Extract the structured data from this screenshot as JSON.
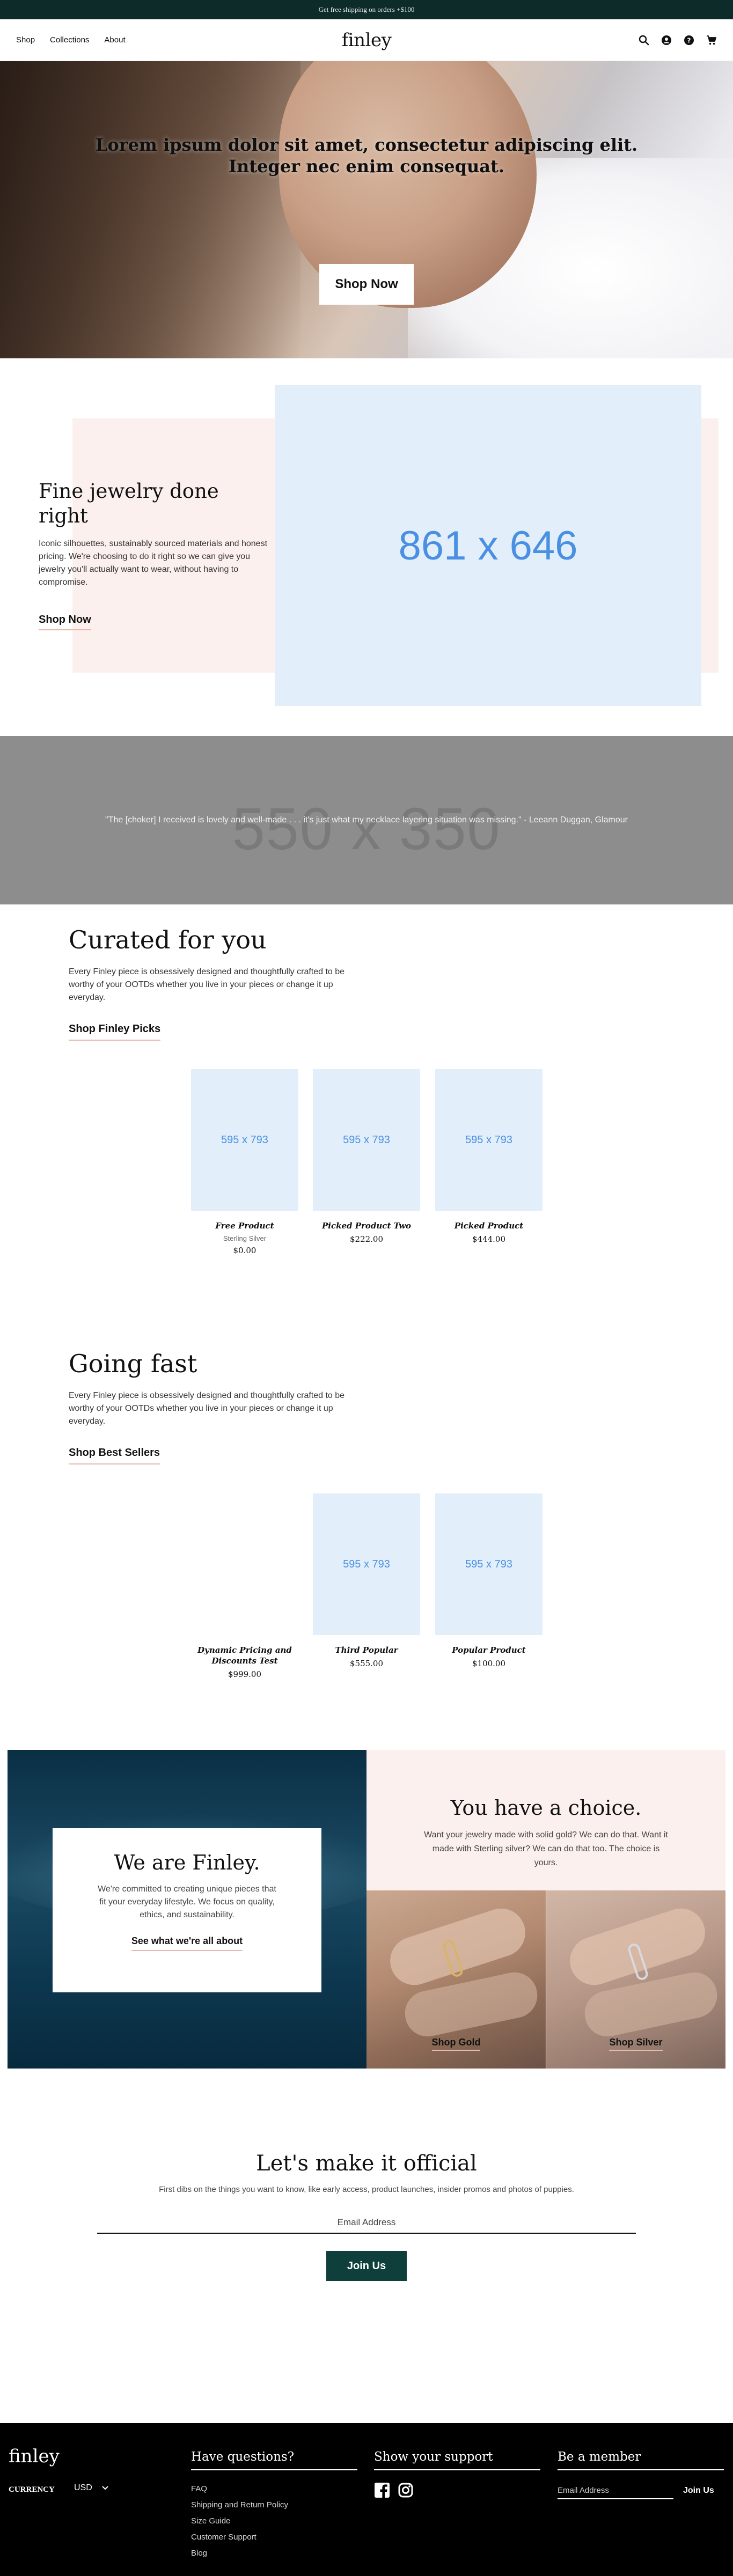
{
  "announcement": "Get free shipping on orders +$100",
  "header": {
    "nav": [
      "Shop",
      "Collections",
      "About"
    ],
    "logo": "finley",
    "icons": [
      "search-icon",
      "account-icon",
      "help-icon",
      "cart-icon"
    ]
  },
  "hero": {
    "title": "Lorem ipsum dolor sit amet, consectetur adipiscing elit. Integer nec enim consequat.",
    "button": "Shop Now"
  },
  "fine_jewelry": {
    "title": "Fine jewelry done right",
    "text": "Iconic silhouettes, sustainably sourced materials and honest pricing. We're choosing to do it right so we can give you jewelry you'll actually want to wear, without having to compromise.",
    "link": "Shop Now",
    "image_placeholder": "861 x 646"
  },
  "quote": {
    "placeholder": "550 x 350",
    "text": "\"The [choker] I received is lovely and well-made . . . it's just what my necklace layering situation was missing.\" - Leeann Duggan, Glamour"
  },
  "curated": {
    "title": "Curated for you",
    "text": "Every Finley piece is obsessively designed and thoughtfully crafted to be worthy of your OOTDs whether you live in your pieces or change it up everyday.",
    "link": "Shop Finley Picks",
    "products": [
      {
        "placeholder": "595 x 793",
        "name": "Free Product",
        "variant": "Sterling Silver",
        "price": "$0.00"
      },
      {
        "placeholder": "595 x 793",
        "name": "Picked Product Two",
        "variant": "",
        "price": "$222.00"
      },
      {
        "placeholder": "595 x 793",
        "name": "Picked Product",
        "variant": "",
        "price": "$444.00"
      }
    ]
  },
  "going_fast": {
    "title": "Going fast",
    "text": "Every Finley piece is obsessively designed and thoughtfully crafted to be worthy of your OOTDs whether you live in your pieces or change it up everyday.",
    "link": "Shop Best Sellers",
    "products": [
      {
        "placeholder": "",
        "name": "Dynamic Pricing and Discounts Test",
        "price": "$999.00"
      },
      {
        "placeholder": "595 x 793",
        "name": "Third Popular",
        "price": "$555.00"
      },
      {
        "placeholder": "595 x 793",
        "name": "Popular Product",
        "price": "$100.00"
      }
    ]
  },
  "about": {
    "title": "We are Finley.",
    "text": "We're committed to creating unique pieces that fit your everyday lifestyle. We focus on quality, ethics, and sustainability.",
    "link": "See what we're all about"
  },
  "choice": {
    "title": "You have a choice.",
    "text": "Want your jewelry made with solid gold? We can do that. Want it made with Sterling silver? We can do that too. The choice is yours.",
    "gold_link": "Shop Gold",
    "silver_link": "Shop Silver"
  },
  "newsletter": {
    "title": "Let's make it official",
    "text": "First dibs on the things you want to know, like early access, product launches, insider promos and photos of puppies.",
    "placeholder": "Email Address",
    "button": "Join Us"
  },
  "footer": {
    "logo": "finley",
    "currency_label": "CURRENCY",
    "currency_value": "USD",
    "questions_title": "Have questions?",
    "questions_links": [
      "FAQ",
      "Shipping and Return Policy",
      "Size Guide",
      "Customer Support",
      "Blog"
    ],
    "support_title": "Show your support",
    "member_title": "Be a member",
    "member_placeholder": "Email Address",
    "member_button": "Join Us"
  },
  "colors": {
    "announcement_bg": "#0d2b29",
    "accent_underline": "#e8b9ad",
    "pink_bg": "#fbf0ee",
    "button_dark": "#0f3f3b",
    "placeholder_bg": "#e2eefa",
    "placeholder_text": "#4a90e2"
  }
}
